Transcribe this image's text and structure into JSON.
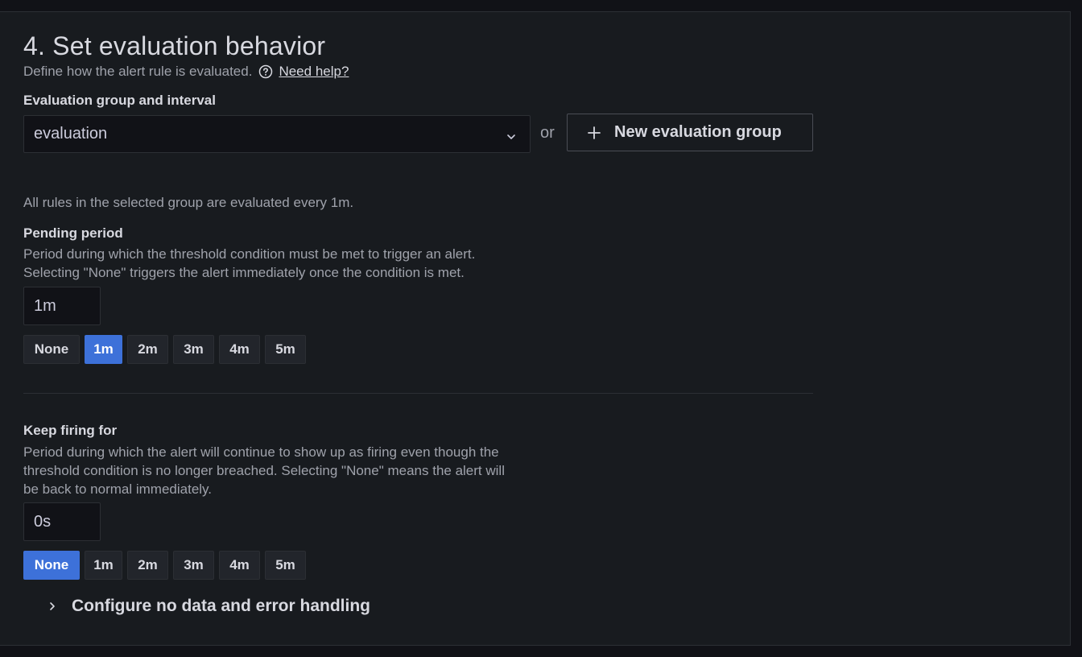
{
  "section": {
    "title": "4. Set evaluation behavior",
    "subtitle": "Define how the alert rule is evaluated.",
    "help_link": "Need help?"
  },
  "evaluation_group": {
    "label": "Evaluation group and interval",
    "selected_value": "evaluation",
    "or_text": "or",
    "new_group_button": "New evaluation group",
    "info_text": "All rules in the selected group are evaluated every 1m."
  },
  "pending_period": {
    "label": "Pending period",
    "description_line1": "Period during which the threshold condition must be met to trigger an alert.",
    "description_line2": "Selecting \"None\" triggers the alert immediately once the condition is met.",
    "input_value": "1m",
    "options": [
      "None",
      "1m",
      "2m",
      "3m",
      "4m",
      "5m"
    ],
    "selected": "1m"
  },
  "keep_firing": {
    "label": "Keep firing for",
    "description_line1": "Period during which the alert will continue to show up as firing even though the",
    "description_line2": "threshold condition is no longer breached. Selecting \"None\" means the alert will",
    "description_line3": "be back to normal immediately.",
    "input_value": "0s",
    "options": [
      "None",
      "1m",
      "2m",
      "3m",
      "4m",
      "5m"
    ],
    "selected": "None"
  },
  "no_data_section": {
    "label": "Configure no data and error handling"
  },
  "colors": {
    "background": "#181b1f",
    "accent": "#3d71d9",
    "text_primary": "#d8d9e0",
    "text_secondary": "#9fa2ab"
  }
}
